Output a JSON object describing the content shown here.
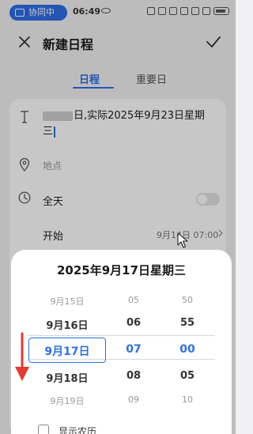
{
  "status_bar": {
    "collab_label": "协同中",
    "time": "06:49"
  },
  "header": {
    "title": "新建日程"
  },
  "tabs": [
    {
      "label": "日程",
      "active": true
    },
    {
      "label": "重要日",
      "active": false
    }
  ],
  "form": {
    "title_line1": "日,实际2025年9月23日星期",
    "title_line2": "三",
    "location_placeholder": "地点",
    "all_day_label": "全天",
    "all_day_on": false,
    "start_label": "开始",
    "start_value": "9月14日 07:00"
  },
  "picker": {
    "selected_date_full": "2025年9月17日星期三",
    "dates": [
      "9月15日",
      "9月16日",
      "9月17日",
      "9月18日",
      "9月19日"
    ],
    "hours": [
      "05",
      "06",
      "07",
      "08",
      "09"
    ],
    "minutes": [
      "50",
      "55",
      "00",
      "05",
      "10"
    ],
    "lunar_label": "显示农历",
    "lunar_checked": false
  },
  "colors": {
    "accent": "#2e6fe6",
    "annotation_arrow": "#e53935"
  },
  "icons": {
    "close": "close-icon",
    "confirm": "check-icon",
    "title": "text-cursor-icon",
    "location": "location-pin-icon",
    "time": "clock-icon",
    "start_chevron": "chevron-right-icon"
  }
}
